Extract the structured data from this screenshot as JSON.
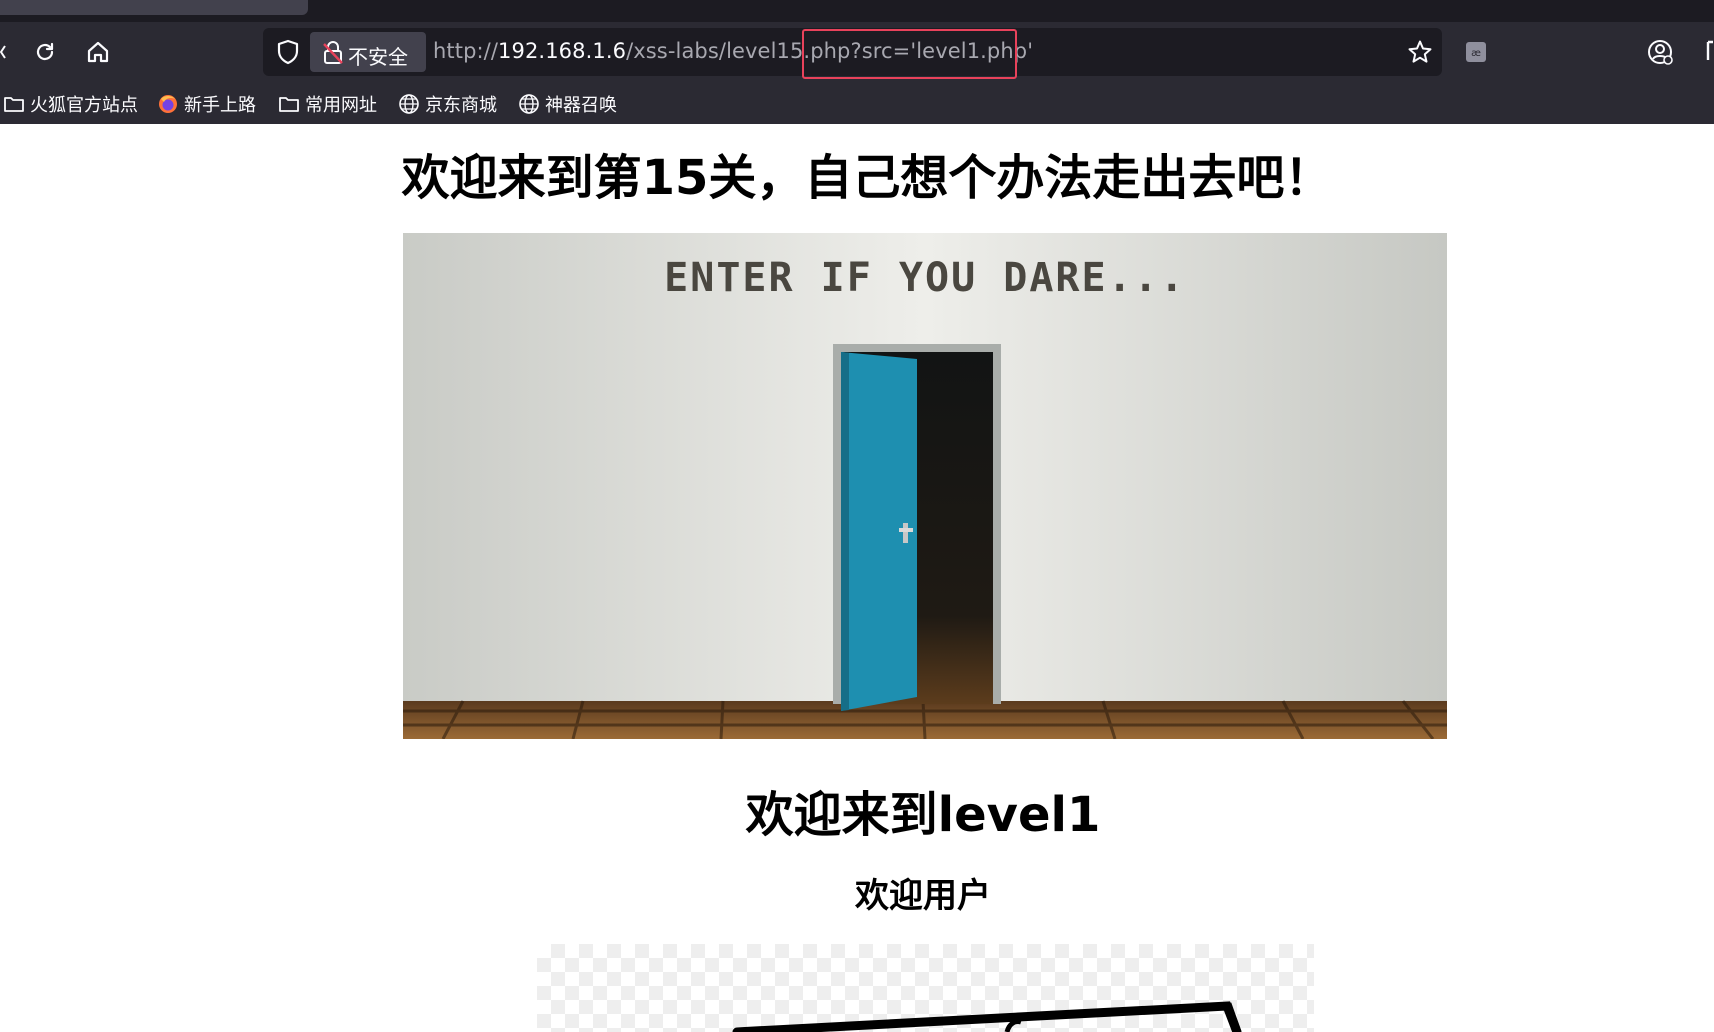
{
  "browser": {
    "security_label": "不安全",
    "url_scheme": "http://",
    "url_host": "192.168.1.6",
    "url_path": "/xss-labs/level15.php?src='level1.php'",
    "bookmarks": [
      {
        "label": "火狐官方站点",
        "icon": "folder-icon"
      },
      {
        "label": "新手上路",
        "icon": "firefox-icon"
      },
      {
        "label": "常用网址",
        "icon": "folder-icon"
      },
      {
        "label": "京东商城",
        "icon": "globe-icon"
      },
      {
        "label": "神器召唤",
        "icon": "globe-icon"
      }
    ],
    "highlight_color": "#e8425b"
  },
  "page": {
    "title": "欢迎来到第15关，自己想个办法走出去吧！",
    "banner_text": "ENTER IF YOU DARE...",
    "included_heading": "欢迎来到level1",
    "included_subheading": "欢迎用户"
  },
  "colors": {
    "chrome_dark": "#2b2a33",
    "url_field": "#1c1b22",
    "door_blue": "#1e8fb0"
  }
}
